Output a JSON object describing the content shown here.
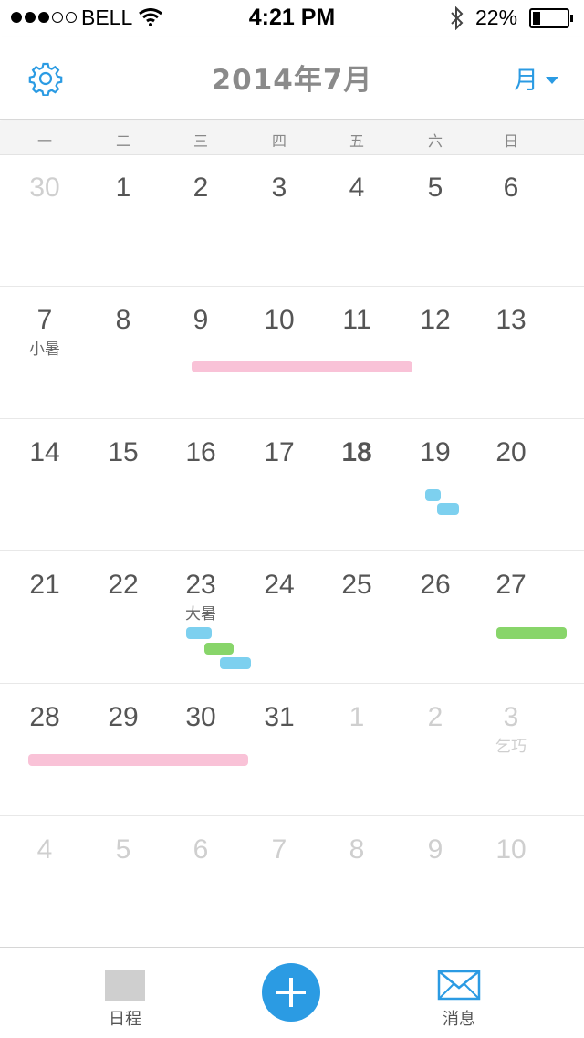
{
  "status_bar": {
    "carrier": "BELL",
    "time": "4:21 PM",
    "battery": "22%"
  },
  "header": {
    "title": "2014年7月",
    "view_mode": "月"
  },
  "weekdays": [
    "一",
    "二",
    "三",
    "四",
    "五",
    "六",
    "日"
  ],
  "weeks": [
    {
      "days": [
        "30",
        "1",
        "2",
        "3",
        "4",
        "5",
        "6"
      ]
    },
    {
      "days": [
        "7",
        "8",
        "9",
        "10",
        "11",
        "12",
        "13"
      ]
    },
    {
      "days": [
        "14",
        "15",
        "16",
        "17",
        "18",
        "19",
        "20"
      ]
    },
    {
      "days": [
        "21",
        "22",
        "23",
        "24",
        "25",
        "26",
        "27"
      ]
    },
    {
      "days": [
        "28",
        "29",
        "30",
        "31",
        "1",
        "2",
        "3"
      ]
    },
    {
      "days": [
        "4",
        "5",
        "6",
        "7",
        "8",
        "9",
        "10"
      ]
    }
  ],
  "solar_terms": {
    "jul7": "小暑",
    "jul23": "大暑",
    "aug3": "乞巧"
  },
  "today": "18",
  "event_colors": {
    "pink": "#f9c2d7",
    "blue": "#7dd0ef",
    "green": "#88d56a",
    "accent": "#2b9be3"
  },
  "tab_bar": {
    "schedule": "日程",
    "messages": "消息"
  }
}
